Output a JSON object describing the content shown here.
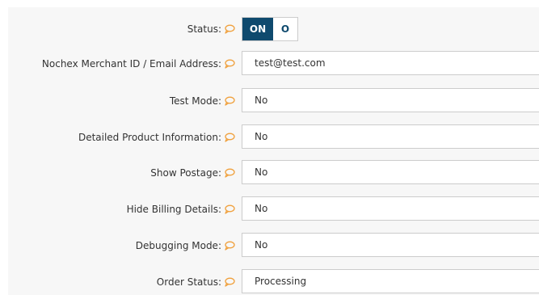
{
  "form": {
    "fields": [
      {
        "label": "Status:",
        "type": "toggle",
        "on_label": "ON",
        "off_label": "O"
      },
      {
        "label": "Nochex Merchant ID / Email Address:",
        "type": "text",
        "value": "test@test.com"
      },
      {
        "label": "Test Mode:",
        "type": "select",
        "value": "No"
      },
      {
        "label": "Detailed Product Information:",
        "type": "select",
        "value": "No"
      },
      {
        "label": "Show Postage:",
        "type": "select",
        "value": "No"
      },
      {
        "label": "Hide Billing Details:",
        "type": "select",
        "value": "No"
      },
      {
        "label": "Debugging Mode:",
        "type": "select",
        "value": "No"
      },
      {
        "label": "Order Status:",
        "type": "select",
        "value": "Processing"
      }
    ]
  },
  "icons": {
    "help": "speech-bubble-icon"
  },
  "colors": {
    "toggle_on_bg": "#0f4a6e",
    "help_icon": "#f0a03c",
    "panel_bg": "#f7f7f7",
    "field_border": "#cccccc"
  }
}
